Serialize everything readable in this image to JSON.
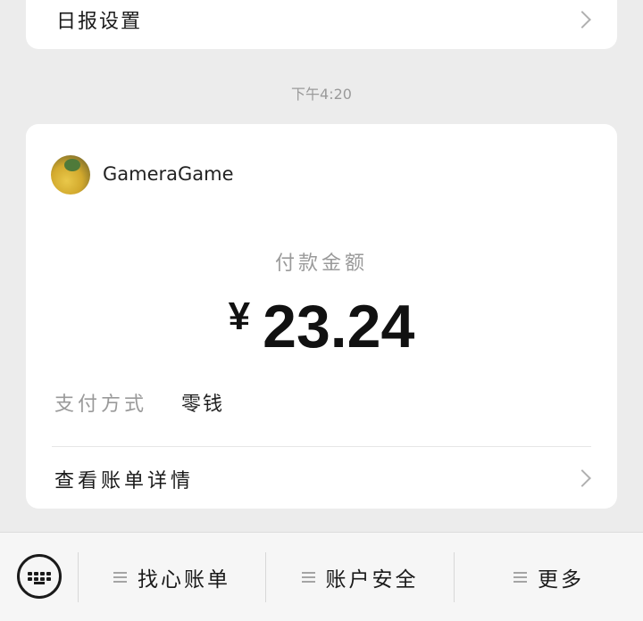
{
  "top_card": {
    "label": "日报设置"
  },
  "timestamp": "下午4:20",
  "payment_card": {
    "merchant": "GameraGame",
    "amount_label": "付款金额",
    "currency": "¥",
    "amount": "23.24",
    "payment_method_label": "支付方式",
    "payment_method_value": "零钱",
    "detail_link": "查看账单详情"
  },
  "bottom_menu": {
    "items": [
      {
        "label": "找心账单"
      },
      {
        "label": "账户安全"
      },
      {
        "label": "更多"
      }
    ]
  },
  "icons": {
    "chevron": "chevron-right-icon",
    "keyboard": "keyboard-icon",
    "menu": "hamburger-icon"
  }
}
